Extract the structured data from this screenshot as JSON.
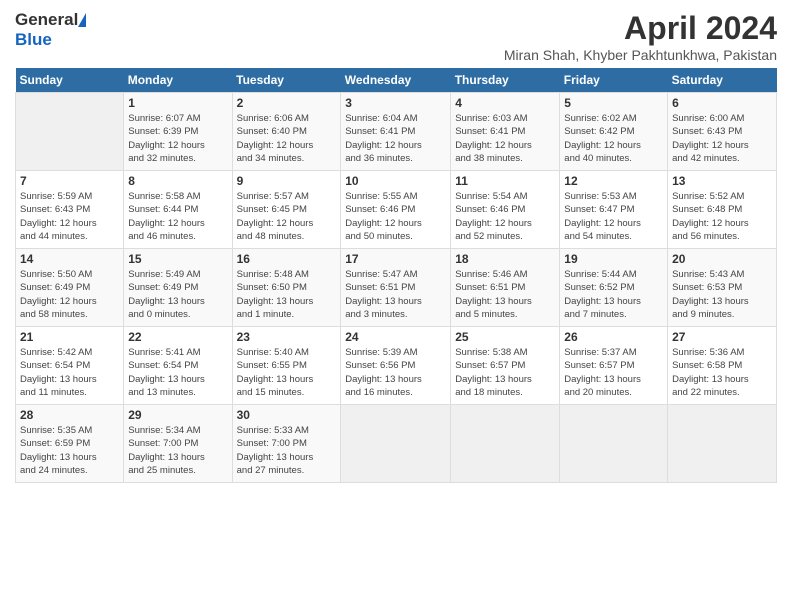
{
  "header": {
    "logo_general": "General",
    "logo_blue": "Blue",
    "title": "April 2024",
    "subtitle": "Miran Shah, Khyber Pakhtunkhwa, Pakistan"
  },
  "days_of_week": [
    "Sunday",
    "Monday",
    "Tuesday",
    "Wednesday",
    "Thursday",
    "Friday",
    "Saturday"
  ],
  "weeks": [
    [
      {
        "day": "",
        "info": ""
      },
      {
        "day": "1",
        "info": "Sunrise: 6:07 AM\nSunset: 6:39 PM\nDaylight: 12 hours\nand 32 minutes."
      },
      {
        "day": "2",
        "info": "Sunrise: 6:06 AM\nSunset: 6:40 PM\nDaylight: 12 hours\nand 34 minutes."
      },
      {
        "day": "3",
        "info": "Sunrise: 6:04 AM\nSunset: 6:41 PM\nDaylight: 12 hours\nand 36 minutes."
      },
      {
        "day": "4",
        "info": "Sunrise: 6:03 AM\nSunset: 6:41 PM\nDaylight: 12 hours\nand 38 minutes."
      },
      {
        "day": "5",
        "info": "Sunrise: 6:02 AM\nSunset: 6:42 PM\nDaylight: 12 hours\nand 40 minutes."
      },
      {
        "day": "6",
        "info": "Sunrise: 6:00 AM\nSunset: 6:43 PM\nDaylight: 12 hours\nand 42 minutes."
      }
    ],
    [
      {
        "day": "7",
        "info": "Sunrise: 5:59 AM\nSunset: 6:43 PM\nDaylight: 12 hours\nand 44 minutes."
      },
      {
        "day": "8",
        "info": "Sunrise: 5:58 AM\nSunset: 6:44 PM\nDaylight: 12 hours\nand 46 minutes."
      },
      {
        "day": "9",
        "info": "Sunrise: 5:57 AM\nSunset: 6:45 PM\nDaylight: 12 hours\nand 48 minutes."
      },
      {
        "day": "10",
        "info": "Sunrise: 5:55 AM\nSunset: 6:46 PM\nDaylight: 12 hours\nand 50 minutes."
      },
      {
        "day": "11",
        "info": "Sunrise: 5:54 AM\nSunset: 6:46 PM\nDaylight: 12 hours\nand 52 minutes."
      },
      {
        "day": "12",
        "info": "Sunrise: 5:53 AM\nSunset: 6:47 PM\nDaylight: 12 hours\nand 54 minutes."
      },
      {
        "day": "13",
        "info": "Sunrise: 5:52 AM\nSunset: 6:48 PM\nDaylight: 12 hours\nand 56 minutes."
      }
    ],
    [
      {
        "day": "14",
        "info": "Sunrise: 5:50 AM\nSunset: 6:49 PM\nDaylight: 12 hours\nand 58 minutes."
      },
      {
        "day": "15",
        "info": "Sunrise: 5:49 AM\nSunset: 6:49 PM\nDaylight: 13 hours\nand 0 minutes."
      },
      {
        "day": "16",
        "info": "Sunrise: 5:48 AM\nSunset: 6:50 PM\nDaylight: 13 hours\nand 1 minute."
      },
      {
        "day": "17",
        "info": "Sunrise: 5:47 AM\nSunset: 6:51 PM\nDaylight: 13 hours\nand 3 minutes."
      },
      {
        "day": "18",
        "info": "Sunrise: 5:46 AM\nSunset: 6:51 PM\nDaylight: 13 hours\nand 5 minutes."
      },
      {
        "day": "19",
        "info": "Sunrise: 5:44 AM\nSunset: 6:52 PM\nDaylight: 13 hours\nand 7 minutes."
      },
      {
        "day": "20",
        "info": "Sunrise: 5:43 AM\nSunset: 6:53 PM\nDaylight: 13 hours\nand 9 minutes."
      }
    ],
    [
      {
        "day": "21",
        "info": "Sunrise: 5:42 AM\nSunset: 6:54 PM\nDaylight: 13 hours\nand 11 minutes."
      },
      {
        "day": "22",
        "info": "Sunrise: 5:41 AM\nSunset: 6:54 PM\nDaylight: 13 hours\nand 13 minutes."
      },
      {
        "day": "23",
        "info": "Sunrise: 5:40 AM\nSunset: 6:55 PM\nDaylight: 13 hours\nand 15 minutes."
      },
      {
        "day": "24",
        "info": "Sunrise: 5:39 AM\nSunset: 6:56 PM\nDaylight: 13 hours\nand 16 minutes."
      },
      {
        "day": "25",
        "info": "Sunrise: 5:38 AM\nSunset: 6:57 PM\nDaylight: 13 hours\nand 18 minutes."
      },
      {
        "day": "26",
        "info": "Sunrise: 5:37 AM\nSunset: 6:57 PM\nDaylight: 13 hours\nand 20 minutes."
      },
      {
        "day": "27",
        "info": "Sunrise: 5:36 AM\nSunset: 6:58 PM\nDaylight: 13 hours\nand 22 minutes."
      }
    ],
    [
      {
        "day": "28",
        "info": "Sunrise: 5:35 AM\nSunset: 6:59 PM\nDaylight: 13 hours\nand 24 minutes."
      },
      {
        "day": "29",
        "info": "Sunrise: 5:34 AM\nSunset: 7:00 PM\nDaylight: 13 hours\nand 25 minutes."
      },
      {
        "day": "30",
        "info": "Sunrise: 5:33 AM\nSunset: 7:00 PM\nDaylight: 13 hours\nand 27 minutes."
      },
      {
        "day": "",
        "info": ""
      },
      {
        "day": "",
        "info": ""
      },
      {
        "day": "",
        "info": ""
      },
      {
        "day": "",
        "info": ""
      }
    ]
  ]
}
